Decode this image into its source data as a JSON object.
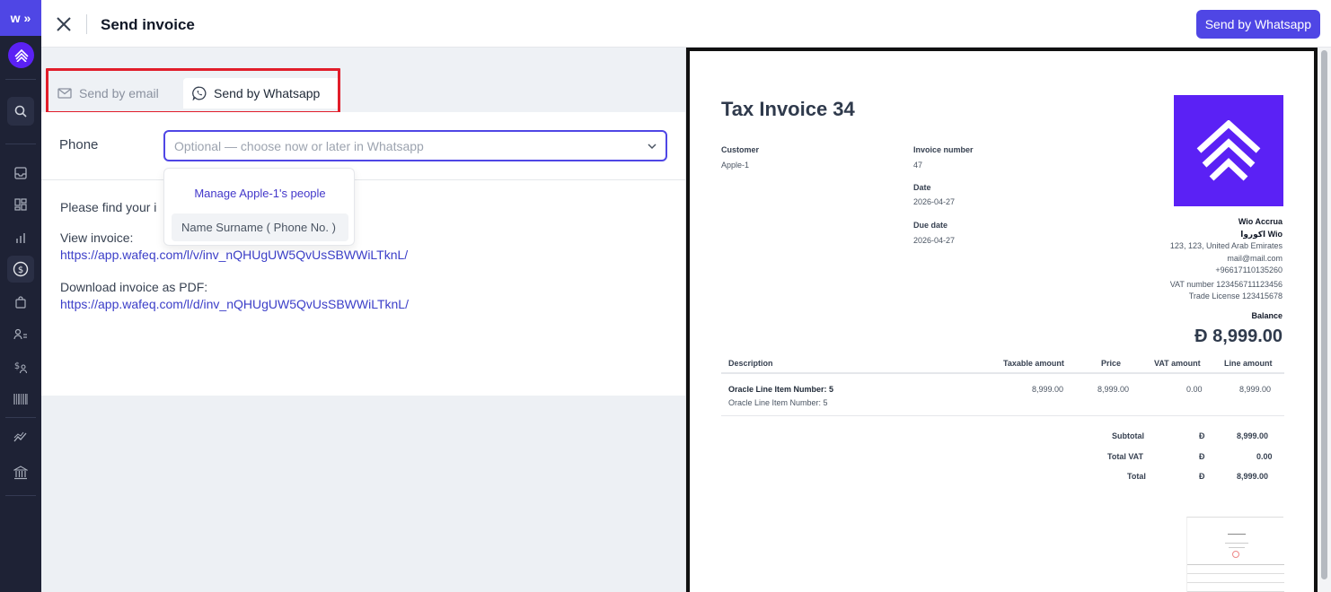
{
  "header": {
    "title": "Send invoice",
    "primary_action": "Send by Whatsapp"
  },
  "rail": {
    "brand": "w",
    "items": [
      "search-icon",
      "inbox-icon",
      "dashboard-icon",
      "chart-icon",
      "money-icon",
      "bag-icon",
      "people-icon",
      "payroll-icon",
      "barcode-icon",
      "analytics-icon",
      "bank-icon"
    ]
  },
  "tabs": {
    "email": "Send by email",
    "whatsapp": "Send by Whatsapp"
  },
  "form": {
    "phone_label": "Phone",
    "phone_placeholder": "Optional — choose now or later in Whatsapp"
  },
  "dropdown": {
    "manage": "Manage Apple-1's people",
    "option": "Name Surname ( Phone No. )"
  },
  "message": {
    "line1": "Please find your i",
    "view_label": "View invoice:",
    "view_link": "https://app.wafeq.com/l/v/inv_nQHUgUW5QvUsSBWWiLTknL/",
    "download_label": "Download invoice as PDF:",
    "download_link": "https://app.wafeq.com/l/d/inv_nQHUgUW5QvUsSBWWiLTknL/"
  },
  "invoice": {
    "title": "Tax Invoice 34",
    "customer_label": "Customer",
    "customer": "Apple-1",
    "number_label": "Invoice number",
    "number": "47",
    "date_label": "Date",
    "date": "2026-04-27",
    "due_label": "Due date",
    "due": "2026-04-27",
    "company_name": "Wio Accrua",
    "company_name_ar": "اكوروا Wio",
    "address": "123, 123, United Arab Emirates",
    "email": "mail@mail.com",
    "phone": "+96617110135260",
    "vat": "VAT number 123456711123456",
    "license": "Trade License 123415678",
    "balance_label": "Balance",
    "balance": "Ð 8,999.00",
    "columns": [
      "Description",
      "Taxable amount",
      "Price",
      "VAT amount",
      "Line amount"
    ],
    "line": {
      "name": "Oracle Line Item Number: 5",
      "desc": "Oracle Line Item Number: 5",
      "taxable": "8,999.00",
      "price": "8,999.00",
      "vat": "0.00",
      "amount": "8,999.00"
    },
    "currency_symbol": "Ð",
    "subtotal_label": "Subtotal",
    "subtotal": "8,999.00",
    "total_vat_label": "Total VAT",
    "total_vat": "0.00",
    "total_label": "Total",
    "total": "8,999.00"
  },
  "colors": {
    "accent": "#4f46e5",
    "brand": "#5b21f5",
    "highlight": "#e11d2a",
    "rail": "#1e2235"
  }
}
